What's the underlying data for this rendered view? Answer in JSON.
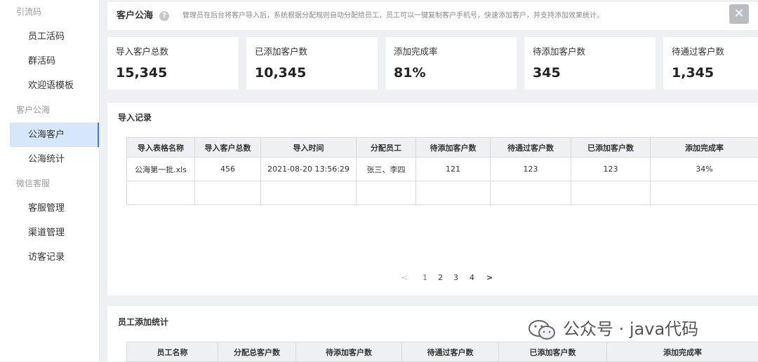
{
  "sidebar": {
    "groups": [
      {
        "title": "引流码",
        "items": [
          "员工活码",
          "群活码",
          "欢迎语模板"
        ]
      },
      {
        "title": "客户公海",
        "items": [
          "公海客户",
          "公海统计"
        ]
      },
      {
        "title": "微信客服",
        "items": [
          "客服管理",
          "渠道管理",
          "访客记录"
        ]
      }
    ],
    "active": "公海客户"
  },
  "header": {
    "title": "客户公海",
    "help_glyph": "?",
    "description": "管理员在后台将客户导入后，系统根据分配规则自动分配给员工，员工可以一键复制客户手机号，快速添加客户，并支持添加效果统计。",
    "close_glyph": "✕"
  },
  "stats": [
    {
      "label": "导入客户总数",
      "value": "15,345"
    },
    {
      "label": "已添加客户数",
      "value": "10,345"
    },
    {
      "label": "添加完成率",
      "value": "81%"
    },
    {
      "label": "待添加客户数",
      "value": "345"
    },
    {
      "label": "待通过客户数",
      "value": "1,345"
    }
  ],
  "import_records": {
    "title": "导入记录",
    "columns": [
      "导入表格名称",
      "导入客户总数",
      "导入时间",
      "分配员工",
      "待添加客户数",
      "待通过客户数",
      "已添加客户数",
      "添加完成率"
    ],
    "rows": [
      [
        "公海第一批.xls",
        "456",
        "2021-08-20 13:56:29",
        "张三、李四",
        "121",
        "123",
        "123",
        "34%"
      ],
      [
        "",
        "",
        "",
        "",
        "",
        "",
        "",
        ""
      ]
    ]
  },
  "pagination": {
    "prev": "<",
    "pages": [
      "1",
      "2",
      "3",
      "4"
    ],
    "current": "1",
    "next": ">"
  },
  "staff_stats": {
    "title": "员工添加统计",
    "columns": [
      "员工名称",
      "分配总客户数",
      "待添加客户数",
      "待通过客户数",
      "已添加客户数",
      "添加完成率"
    ]
  },
  "watermark": {
    "text": "公众号 · java代码"
  },
  "colors": {
    "accent": "#3b82d6",
    "active_bg": "#d6e7fb",
    "page_bg": "#eef0f3"
  }
}
